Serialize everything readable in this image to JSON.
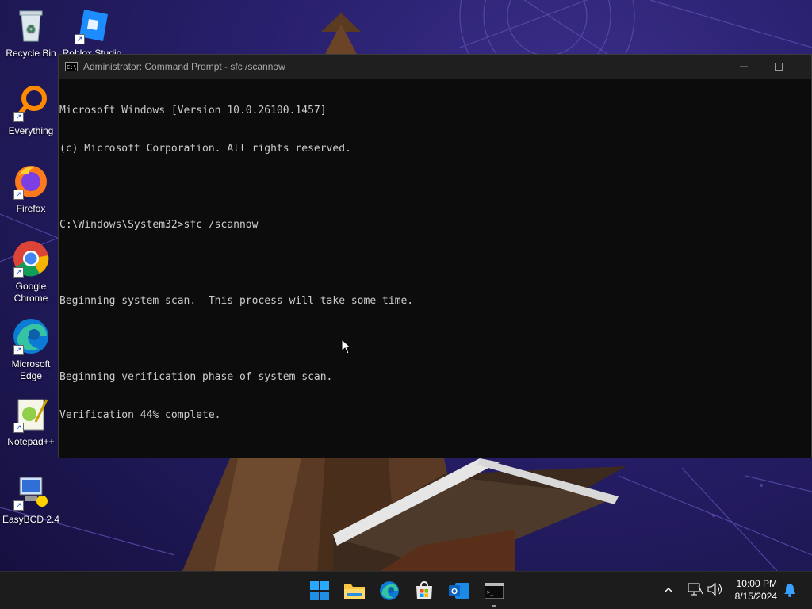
{
  "desktop": {
    "icons": [
      {
        "label": "Recycle Bin",
        "icon": "recycle-bin-icon"
      },
      {
        "label": "Roblox Studio",
        "icon": "roblox-studio-icon"
      },
      {
        "label": "Everything",
        "icon": "everything-search-icon"
      },
      {
        "label": "Firefox",
        "icon": "firefox-icon"
      },
      {
        "label": "Google Chrome",
        "icon": "chrome-icon"
      },
      {
        "label": "Microsoft Edge",
        "icon": "edge-icon"
      },
      {
        "label": "Notepad++",
        "icon": "notepadpp-icon"
      },
      {
        "label": "EasyBCD 2.4",
        "icon": "easybcd-icon"
      }
    ]
  },
  "window": {
    "title": "Administrator: Command Prompt - sfc  /scannow",
    "icon_label": "C:\\",
    "lines": [
      "Microsoft Windows [Version 10.0.26100.1457]",
      "(c) Microsoft Corporation. All rights reserved.",
      "",
      "C:\\Windows\\System32>sfc /scannow",
      "",
      "Beginning system scan.  This process will take some time.",
      "",
      "Beginning verification phase of system scan.",
      "Verification 44% complete."
    ]
  },
  "taskbar": {
    "apps": [
      "start-icon",
      "file-explorer-icon",
      "edge-icon",
      "microsoft-store-icon",
      "outlook-icon",
      "terminal-icon"
    ],
    "time": "10:00 PM",
    "date": "8/15/2024"
  },
  "colors": {
    "console_text": "#cccccc",
    "console_bg": "#0c0c0c",
    "taskbar_bg": "#1c1c1c"
  }
}
